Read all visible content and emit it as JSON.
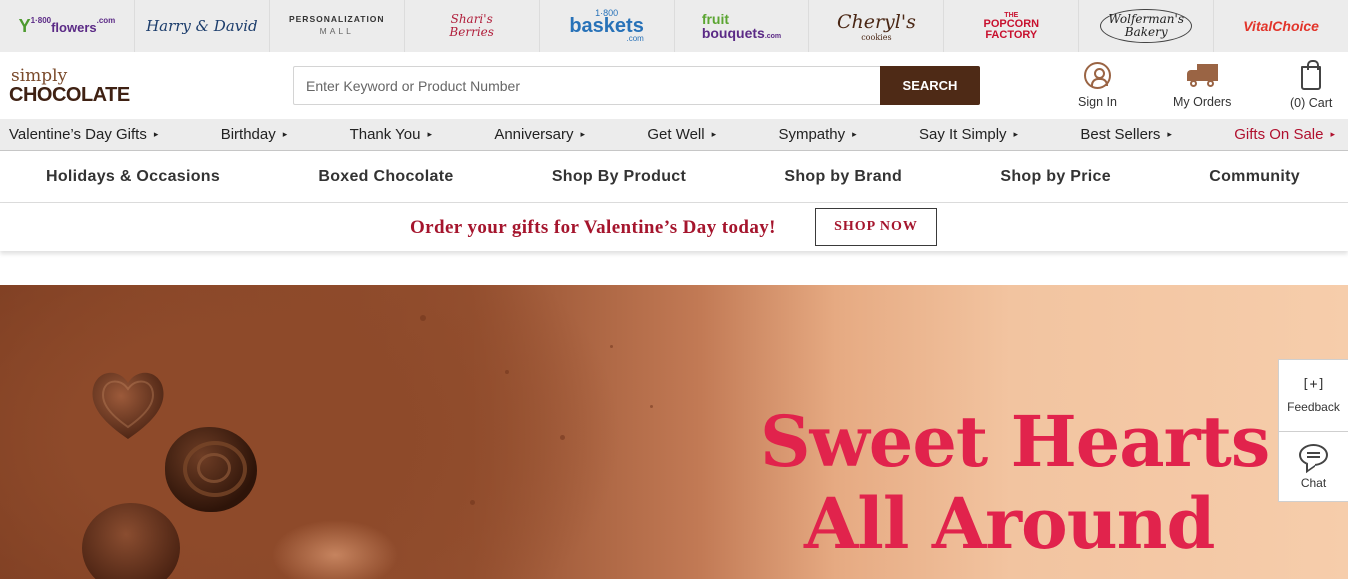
{
  "brands": [
    {
      "name": "flowers-logo",
      "parts": [
        "1·800",
        "flowers",
        ".com"
      ]
    },
    {
      "name": "harry-david-logo",
      "parts": [
        "Harry & David"
      ]
    },
    {
      "name": "personalization-mall-logo",
      "parts": [
        "PERSONALIZATION",
        "MALL"
      ]
    },
    {
      "name": "sharis-berries-logo",
      "parts": [
        "Shari's",
        "Berries"
      ]
    },
    {
      "name": "baskets-logo",
      "parts": [
        "1·800",
        "baskets",
        ".com"
      ]
    },
    {
      "name": "fruit-bouquets-logo",
      "parts": [
        "fruit",
        "bouquets",
        ".com"
      ]
    },
    {
      "name": "cheryls-logo",
      "parts": [
        "Cheryl's",
        "cookies"
      ]
    },
    {
      "name": "popcorn-factory-logo",
      "parts": [
        "THE",
        "POPCORN",
        "FACTORY"
      ]
    },
    {
      "name": "wolfermans-logo",
      "parts": [
        "Wolferman's",
        "Bakery"
      ]
    },
    {
      "name": "vital-choice-logo",
      "parts": [
        "VitalChoice"
      ]
    }
  ],
  "header": {
    "logo_top": "simply",
    "logo_bottom": "CHOCOLATE",
    "search_placeholder": "Enter Keyword or Product Number",
    "search_button": "SEARCH",
    "sign_in": "Sign In",
    "my_orders": "My Orders",
    "cart": "(0) Cart"
  },
  "occasions": [
    {
      "label": "Valentine’s Day Gifts",
      "arrow": "▸"
    },
    {
      "label": "Birthday",
      "arrow": "▸"
    },
    {
      "label": "Thank You",
      "arrow": "▸"
    },
    {
      "label": "Anniversary",
      "arrow": "▸"
    },
    {
      "label": "Get Well",
      "arrow": "▸"
    },
    {
      "label": "Sympathy",
      "arrow": "▸"
    },
    {
      "label": "Say It Simply",
      "arrow": "▸"
    },
    {
      "label": "Best Sellers",
      "arrow": "▸"
    },
    {
      "label": "Gifts On Sale",
      "arrow": "▸"
    }
  ],
  "categories": [
    "Holidays & Occasions",
    "Boxed Chocolate",
    "Shop By Product",
    "Shop by Brand",
    "Shop by Price",
    "Community"
  ],
  "promo": {
    "message": "Order your gifts for Valentine’s Day today!",
    "button": "SHOP NOW"
  },
  "hero": {
    "line1": "Sweet Hearts",
    "line2": "All Around"
  },
  "side_widget": {
    "feedback_icon": "[+]",
    "feedback_label": "Feedback",
    "chat_label": "Chat"
  },
  "colors": {
    "accent_brown": "#4e2a16",
    "sale_red": "#b0102e",
    "promo_red": "#a5152d",
    "hero_pink": "#e1234c"
  }
}
